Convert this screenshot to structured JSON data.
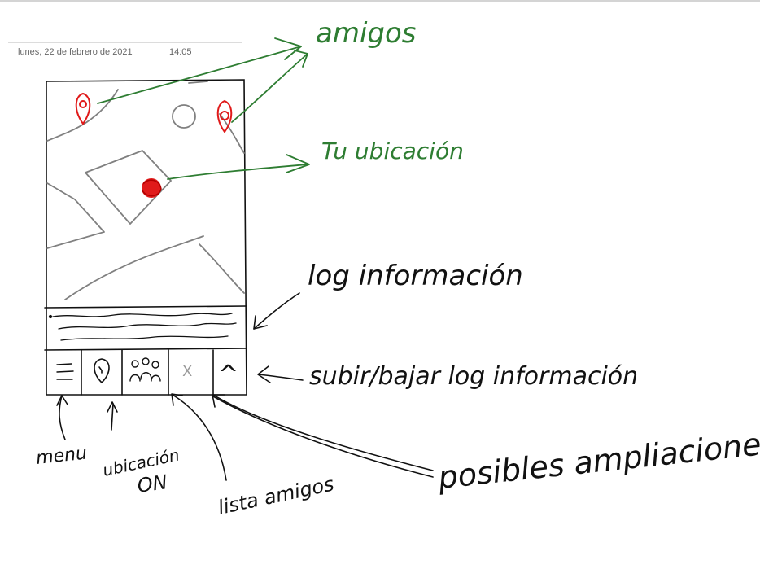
{
  "note": {
    "date": "lunes, 22 de febrero de 2021",
    "time": "14:05"
  },
  "annotations": {
    "amigos": "amigos",
    "tu_ubicacion": "Tu ubicación",
    "log_informacion": "log información",
    "subir_bajar": "subir/bajar log información",
    "menu": "menu",
    "ubicacion_on_1": "ubicación",
    "ubicacion_on_2": "ON",
    "lista_amigos": "lista amigos",
    "posibles_ampliaciones": "posibles ampliaciones"
  },
  "toolbar": {
    "close_glyph": "X",
    "up_glyph": "^"
  },
  "colors": {
    "ink": "#111111",
    "pencil": "#808080",
    "marker_green": "#2e7d32",
    "pin_red": "#e01a1a"
  }
}
